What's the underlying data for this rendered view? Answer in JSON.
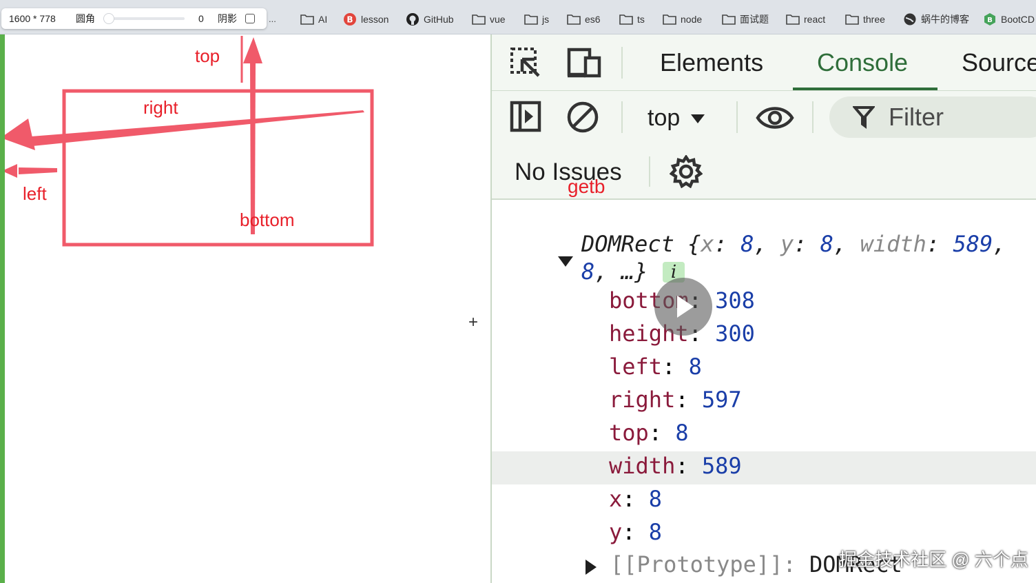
{
  "capture_tool": {
    "size": "1600 * 778",
    "corner_label": "圆角",
    "corner_value": "0",
    "shadow_label": "阴影",
    "slider_value": 0,
    "overflow": "..."
  },
  "bookmarks": [
    {
      "label": "AI",
      "icon": "folder-icon"
    },
    {
      "label": "lesson",
      "icon": "lesson-icon"
    },
    {
      "label": "GitHub",
      "icon": "github-icon"
    },
    {
      "label": "vue",
      "icon": "folder-icon"
    },
    {
      "label": "js",
      "icon": "folder-icon"
    },
    {
      "label": "es6",
      "icon": "folder-icon"
    },
    {
      "label": "ts",
      "icon": "folder-icon"
    },
    {
      "label": "node",
      "icon": "folder-icon"
    },
    {
      "label": "面试题",
      "icon": "folder-icon"
    },
    {
      "label": "react",
      "icon": "folder-icon"
    },
    {
      "label": "three",
      "icon": "folder-icon"
    },
    {
      "label": "蜗牛的博客",
      "icon": "globe-icon"
    },
    {
      "label": "BootCD",
      "icon": "bootcdn-icon"
    }
  ],
  "annotation": {
    "top": "top",
    "right": "right",
    "left": "left",
    "bottom": "bottom",
    "getb": "getb",
    "color": "#e8202a",
    "box_color": "#f05a6a"
  },
  "devtools": {
    "tabs": [
      "Elements",
      "Console",
      "Source"
    ],
    "active_tab": "Console",
    "context": "top",
    "filter_placeholder": "Filter",
    "issues": "No Issues",
    "accent": "#2f6e3a"
  },
  "console": {
    "head_type": "DOMRect",
    "head_open": "{",
    "head_x_key": "x",
    "head_x_val": "8",
    "head_y_key": "y",
    "head_y_val": "8",
    "head_w_key": "width",
    "head_w_val": "589",
    "head_line2_val": "8",
    "head_line2_rest": ", …}",
    "info_badge": "i",
    "props": [
      {
        "key": "bottom",
        "value": "308"
      },
      {
        "key": "height",
        "value": "300"
      },
      {
        "key": "left",
        "value": "8"
      },
      {
        "key": "right",
        "value": "597"
      },
      {
        "key": "top",
        "value": "8"
      },
      {
        "key": "width",
        "value": "589"
      },
      {
        "key": "x",
        "value": "8"
      },
      {
        "key": "y",
        "value": "8"
      }
    ],
    "prototype_key": "[[Prototype]]",
    "prototype_value": "DOMRect"
  },
  "watermark": "掘金技术社区 @ 六个点"
}
